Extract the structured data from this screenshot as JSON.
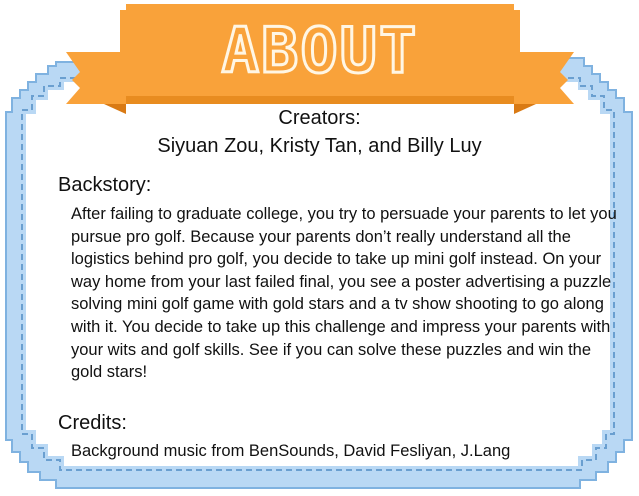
{
  "title": "ABOUT",
  "creators": {
    "heading": "Creators:",
    "names": "Siyuan Zou, Kristy Tan, and Billy Luy"
  },
  "backstory": {
    "heading": "Backstory:",
    "text": "After failing to graduate college, you try to persuade your parents to let you pursue pro golf. Because your parents don’t really understand all the logistics behind pro golf, you decide to take up mini golf instead. On your way home from your last failed final, you see a poster advertising a puzzle solving mini golf game with gold stars and a tv show shooting to go along with it. You decide to take up this challenge and impress your parents with your wits and golf skills. See if you can solve these puzzles and win the gold stars!"
  },
  "credits": {
    "heading": "Credits:",
    "text": "Background music from BenSounds, David Fesliyan, J.Lang"
  },
  "colors": {
    "banner": "#f9a23a",
    "banner_shadow": "#e88c20",
    "ribbon_fold": "#d97a14",
    "frame_light": "#b9d8f4",
    "frame_dark": "#6a9fd0",
    "panel": "#ffffff",
    "title_text": "#fff6e4"
  }
}
